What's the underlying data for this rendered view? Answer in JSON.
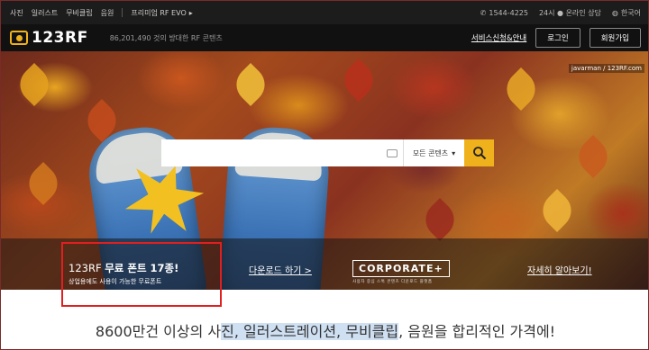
{
  "topbar": {
    "nav": [
      "사진",
      "일러스트",
      "무비클립",
      "음원"
    ],
    "evo_label": "프리미엄 RF EVO",
    "phone": "1544-4225",
    "chat": "24시 ● 온라인 상담",
    "language": "한국어"
  },
  "header": {
    "logo": "123RF",
    "tagline": "86,201,490 것의 방대한 RF 콘텐츠",
    "service_link": "서비스신청&안내",
    "login": "로그인",
    "signup": "회원가입"
  },
  "hero": {
    "image_credit": "javarman / 123RF.com",
    "search": {
      "placeholder": "",
      "scope": "모든 콘텐츠"
    }
  },
  "banner": {
    "promo_title_prefix": "123RF ",
    "promo_title_bold": "무료 폰트 17종!",
    "promo_sub": "상업용에도 사용이 가능한 무료폰트",
    "download_link": "다운로드 하기 >",
    "corporate_logo": "CORPORATE+",
    "corporate_sub": "사용자 중심 스톡 콘텐츠 다운로드 플랫폼",
    "learn_link": "자세히 알아보기!"
  },
  "bottom": {
    "text_pre": "8600만건 이상의 사",
    "text_hl1": "진, 일러스트레이션, 무비클",
    "text_mid": "립",
    "text_post": ", 음원을 합리적인 가격에!"
  },
  "colors": {
    "accent": "#f0b21c",
    "highlight_box": "#e02020",
    "topbar_bg": "#1c1c1c",
    "header_bg": "#111111"
  }
}
